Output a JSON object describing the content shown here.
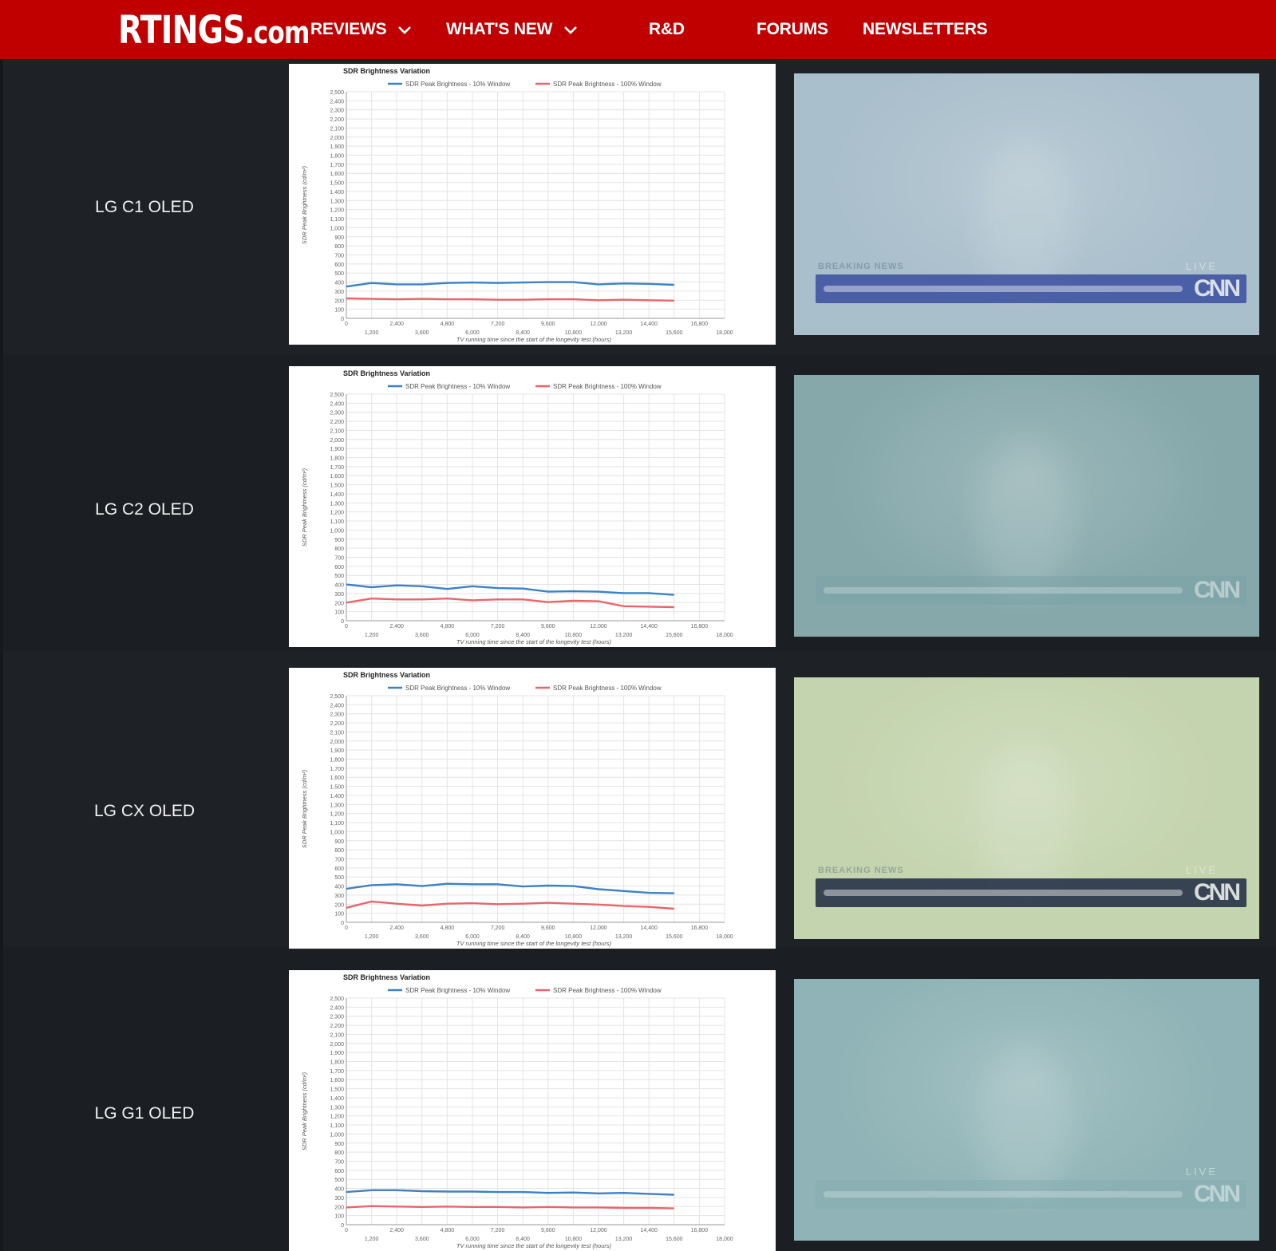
{
  "nav": {
    "logo_big": "RTINGS",
    "logo_small": ".com",
    "items": [
      {
        "label": "REVIEWS",
        "dropdown": true
      },
      {
        "label": "WHAT'S NEW",
        "dropdown": true
      },
      {
        "label": "R&D",
        "dropdown": false
      },
      {
        "label": "FORUMS",
        "dropdown": false
      },
      {
        "label": "NEWSLETTERS",
        "dropdown": false
      }
    ]
  },
  "colors": {
    "nav_bg": "#c00000",
    "series_10": "#3b82c4",
    "series_100": "#e8666b",
    "page_bg": "#1b1e22"
  },
  "rows": [
    {
      "label": "LG C1 OLED",
      "photo": {
        "tint": "#a9bfcb",
        "ticker": "#3b4fa0",
        "caption": "BREAKING NEWS",
        "live": "LIVE",
        "logo": "CNN"
      }
    },
    {
      "label": "LG C2 OLED",
      "photo": {
        "tint": "#86a8ab",
        "ticker": "#7aa3a8",
        "caption": "",
        "live": "",
        "logo": "CNN"
      }
    },
    {
      "label": "LG CX OLED",
      "photo": {
        "tint": "#c4d4ae",
        "ticker": "#1f2a44",
        "caption": "BREAKING NEWS",
        "live": "LIVE",
        "logo": "CNN"
      }
    },
    {
      "label": "LG G1 OLED",
      "photo": {
        "tint": "#8fb3b6",
        "ticker": "#86aeb2",
        "caption": "",
        "live": "LIVE",
        "logo": "CNN"
      }
    }
  ],
  "chart_data": [
    {
      "type": "line",
      "title": "SDR Brightness Variation",
      "xlabel": "TV running time since the start of the longevity test (hours)",
      "ylabel": "SDR Peak Brightness (cd/m²)",
      "xlim": [
        0,
        18000
      ],
      "ylim": [
        0,
        2500
      ],
      "x_ticks_upper": [
        2400,
        4800,
        7200,
        9600,
        12000,
        14400,
        16800
      ],
      "x_ticks_lower": [
        0,
        1200,
        3600,
        6000,
        8400,
        10800,
        13200,
        15600,
        18000
      ],
      "y_ticks": [
        0,
        100,
        200,
        300,
        400,
        500,
        600,
        700,
        800,
        900,
        1000,
        1100,
        1200,
        1300,
        1400,
        1500,
        1600,
        1700,
        1800,
        1900,
        2000,
        2100,
        2200,
        2300,
        2400,
        2500
      ],
      "grid": true,
      "legend": "top",
      "x": [
        0,
        1200,
        2400,
        3600,
        4800,
        6000,
        7200,
        8400,
        9600,
        10800,
        12000,
        13200,
        14400,
        15600
      ],
      "series": [
        {
          "name": "SDR Peak Brightness - 10% Window",
          "values": [
            350,
            390,
            375,
            375,
            390,
            395,
            390,
            395,
            400,
            400,
            375,
            385,
            380,
            370
          ]
        },
        {
          "name": "SDR Peak Brightness - 100% Window",
          "values": [
            220,
            215,
            210,
            215,
            210,
            210,
            205,
            205,
            210,
            210,
            200,
            205,
            200,
            195
          ]
        }
      ]
    },
    {
      "type": "line",
      "title": "SDR Brightness Variation",
      "xlabel": "TV running time since the start of the longevity test (hours)",
      "ylabel": "SDR Peak Brightness (cd/m²)",
      "xlim": [
        0,
        18000
      ],
      "ylim": [
        0,
        2500
      ],
      "x_ticks_upper": [
        2400,
        4800,
        7200,
        9600,
        12000,
        14400,
        16800
      ],
      "x_ticks_lower": [
        0,
        1200,
        3600,
        6000,
        8400,
        10800,
        13200,
        15600,
        18000
      ],
      "y_ticks": [
        0,
        100,
        200,
        300,
        400,
        500,
        600,
        700,
        800,
        900,
        1000,
        1100,
        1200,
        1300,
        1400,
        1500,
        1600,
        1700,
        1800,
        1900,
        2000,
        2100,
        2200,
        2300,
        2400,
        2500
      ],
      "grid": true,
      "legend": "top",
      "x": [
        0,
        1200,
        2400,
        3600,
        4800,
        6000,
        7200,
        8400,
        9600,
        10800,
        12000,
        13200,
        14400,
        15600
      ],
      "series": [
        {
          "name": "SDR Peak Brightness - 10% Window",
          "values": [
            400,
            370,
            390,
            380,
            350,
            380,
            360,
            355,
            320,
            325,
            320,
            305,
            305,
            285
          ]
        },
        {
          "name": "SDR Peak Brightness - 100% Window",
          "values": [
            200,
            245,
            235,
            235,
            245,
            225,
            235,
            235,
            205,
            220,
            215,
            160,
            155,
            150
          ]
        }
      ]
    },
    {
      "type": "line",
      "title": "SDR Brightness Variation",
      "xlabel": "TV running time since the start of the longevity test (hours)",
      "ylabel": "SDR Peak Brightness (cd/m²)",
      "xlim": [
        0,
        18000
      ],
      "ylim": [
        0,
        2500
      ],
      "x_ticks_upper": [
        2400,
        4800,
        7200,
        9600,
        12000,
        14400,
        16800
      ],
      "x_ticks_lower": [
        0,
        1200,
        3600,
        6000,
        8400,
        10800,
        13200,
        15600,
        18000
      ],
      "y_ticks": [
        0,
        100,
        200,
        300,
        400,
        500,
        600,
        700,
        800,
        900,
        1000,
        1100,
        1200,
        1300,
        1400,
        1500,
        1600,
        1700,
        1800,
        1900,
        2000,
        2100,
        2200,
        2300,
        2400,
        2500
      ],
      "grid": true,
      "legend": "top",
      "x": [
        0,
        1200,
        2400,
        3600,
        4800,
        6000,
        7200,
        8400,
        9600,
        10800,
        12000,
        13200,
        14400,
        15600
      ],
      "series": [
        {
          "name": "SDR Peak Brightness - 10% Window",
          "values": [
            370,
            410,
            420,
            400,
            425,
            420,
            420,
            395,
            405,
            400,
            365,
            345,
            325,
            320
          ]
        },
        {
          "name": "SDR Peak Brightness - 100% Window",
          "values": [
            160,
            230,
            205,
            185,
            205,
            210,
            200,
            205,
            215,
            205,
            195,
            180,
            170,
            150
          ]
        }
      ]
    },
    {
      "type": "line",
      "title": "SDR Brightness Variation",
      "xlabel": "TV running time since the start of the longevity test (hours)",
      "ylabel": "SDR Peak Brightness (cd/m²)",
      "xlim": [
        0,
        18000
      ],
      "ylim": [
        0,
        2500
      ],
      "x_ticks_upper": [
        2400,
        4800,
        7200,
        9600,
        12000,
        14400,
        16800
      ],
      "x_ticks_lower": [
        0,
        1200,
        3600,
        6000,
        8400,
        10800,
        13200,
        15600,
        18000
      ],
      "y_ticks": [
        0,
        100,
        200,
        300,
        400,
        500,
        600,
        700,
        800,
        900,
        1000,
        1100,
        1200,
        1300,
        1400,
        1500,
        1600,
        1700,
        1800,
        1900,
        2000,
        2100,
        2200,
        2300,
        2400,
        2500
      ],
      "grid": true,
      "legend": "top",
      "x": [
        0,
        1200,
        2400,
        3600,
        4800,
        6000,
        7200,
        8400,
        9600,
        10800,
        12000,
        13200,
        14400,
        15600
      ],
      "series": [
        {
          "name": "SDR Peak Brightness - 10% Window",
          "values": [
            360,
            380,
            380,
            370,
            365,
            365,
            360,
            360,
            350,
            355,
            345,
            350,
            340,
            330
          ]
        },
        {
          "name": "SDR Peak Brightness - 100% Window",
          "values": [
            190,
            205,
            200,
            195,
            200,
            195,
            195,
            190,
            195,
            190,
            190,
            185,
            185,
            180
          ]
        }
      ]
    }
  ]
}
